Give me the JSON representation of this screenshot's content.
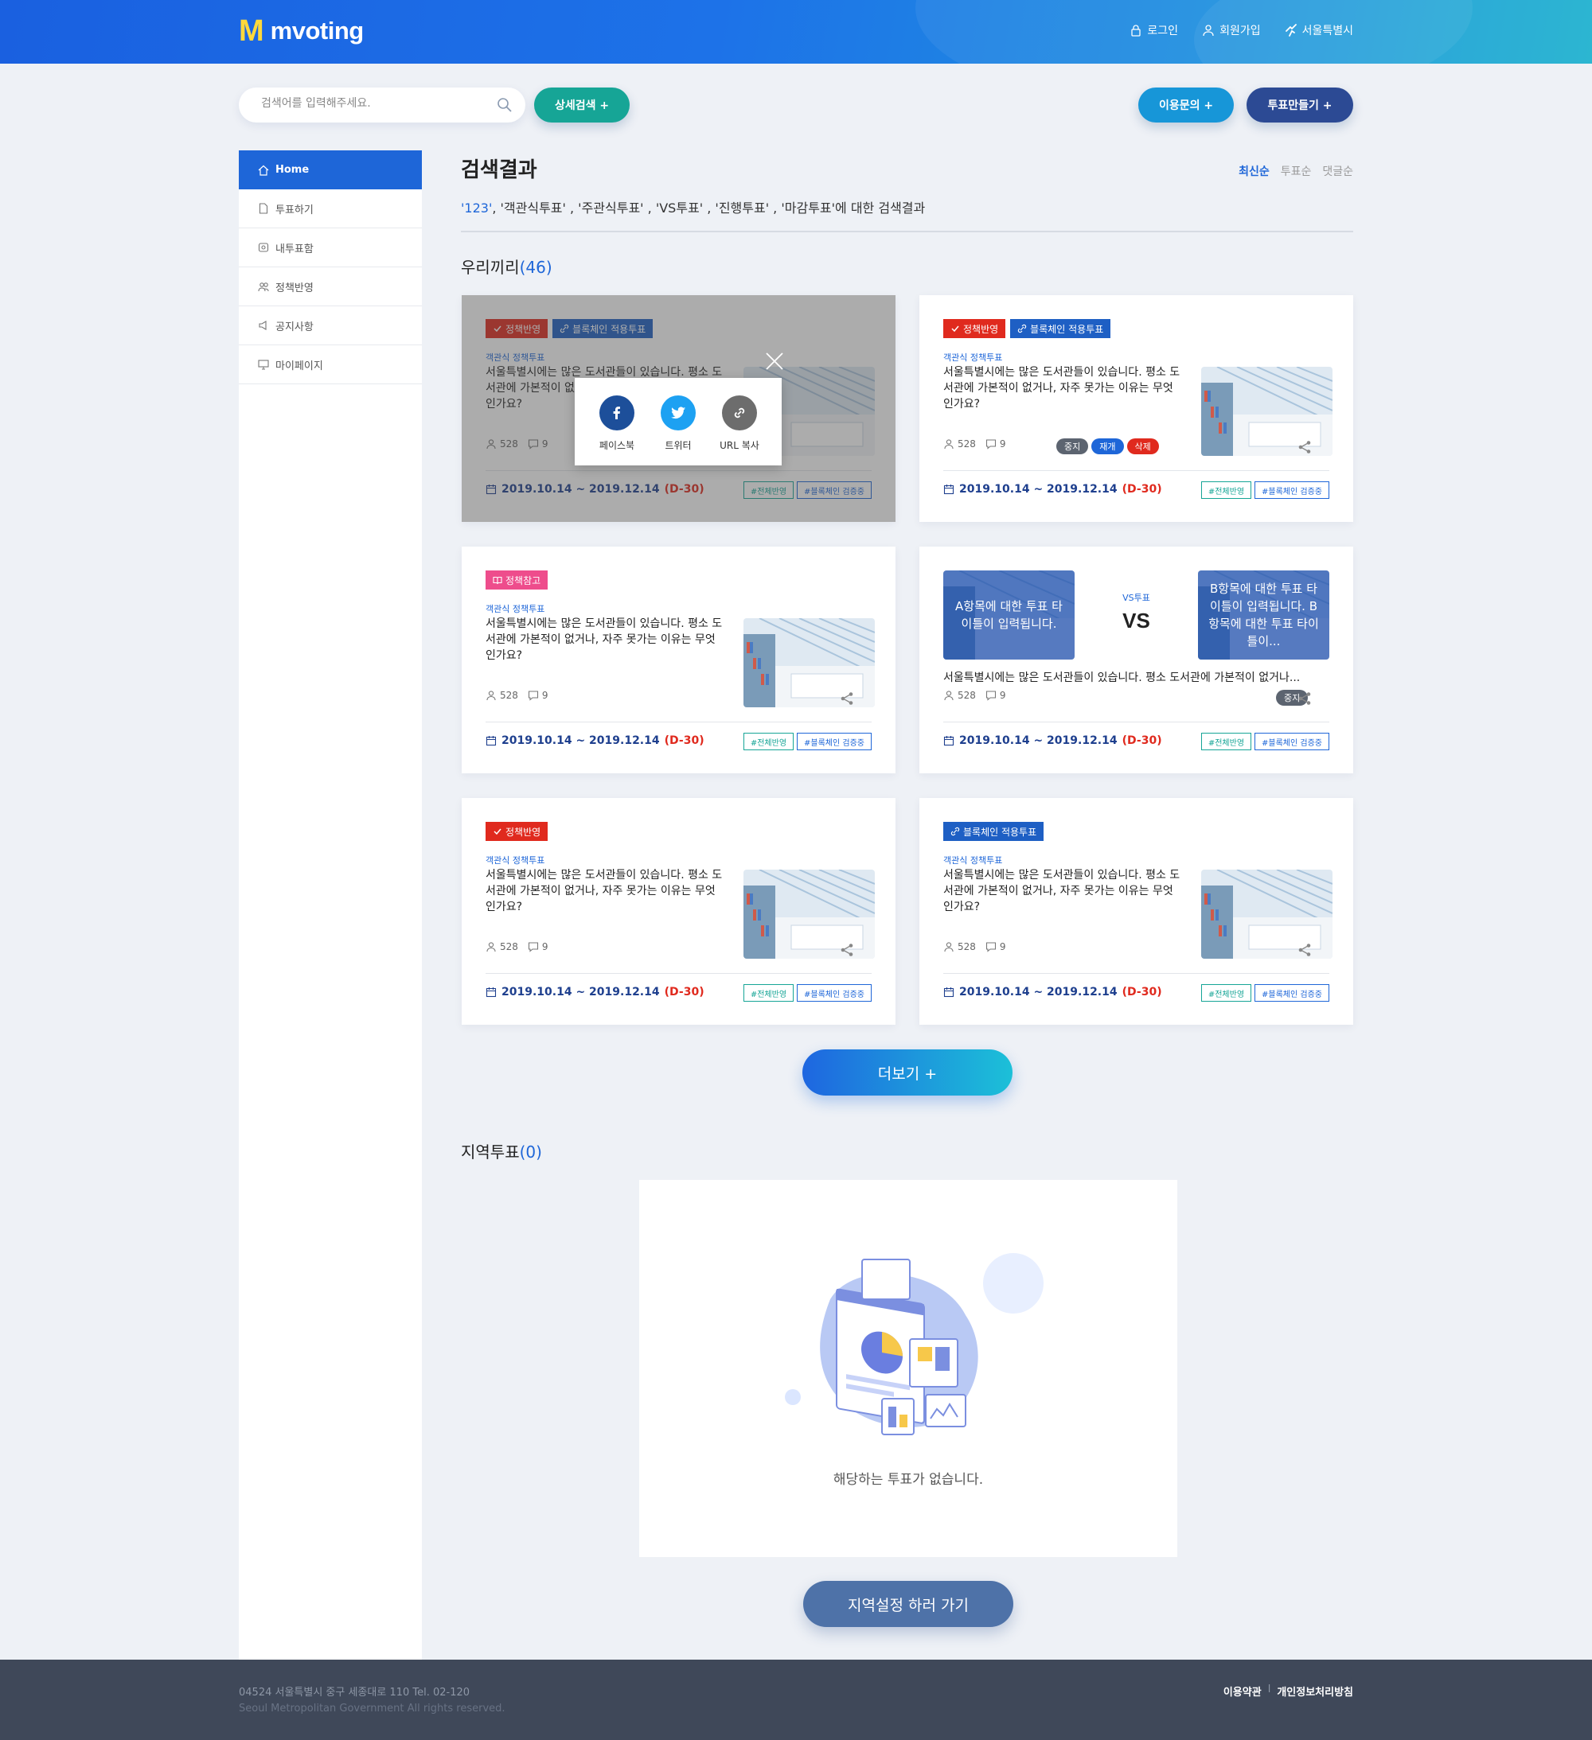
{
  "header": {
    "logo_mark": "M",
    "logo_text": "mvoting",
    "nav": [
      {
        "label": "로그인",
        "icon": "lock-icon"
      },
      {
        "label": "회원가입",
        "icon": "user-icon"
      },
      {
        "label": "서울특별시",
        "icon": "region-icon"
      }
    ]
  },
  "search": {
    "placeholder": "검색어를 입력해주세요.",
    "detail_button": "상세검색 +"
  },
  "actions": {
    "inquiry_button": "이용문의 +",
    "make_vote_button": "투표만들기 +"
  },
  "sidebar": {
    "items": [
      {
        "label": "Home",
        "icon": "home-icon"
      },
      {
        "label": "투표하기",
        "icon": "document-icon"
      },
      {
        "label": "내투표함",
        "icon": "box-icon"
      },
      {
        "label": "정책반영",
        "icon": "people-icon"
      },
      {
        "label": "공지사항",
        "icon": "speaker-icon"
      },
      {
        "label": "마이페이지",
        "icon": "monitor-icon"
      }
    ]
  },
  "results": {
    "title": "검색결과",
    "sort": [
      "최신순",
      "투표순",
      "댓글순"
    ],
    "query_highlight": "'123'",
    "query_rest": ", '객관식투표' , '주관식투표' , 'VS투표' , '진행투표' , '마감투표'에 대한 검색결과"
  },
  "section_ours": {
    "title": "우리끼리",
    "count": "(46)"
  },
  "section_region": {
    "title": "지역투표",
    "count": "(0)"
  },
  "cards": [
    {
      "tags": [
        "정책반영",
        "블록체인 적용투표"
      ],
      "category": "객관식 정책투표",
      "description": "서울특별시에는 많은 도서관들이 있습니다. 평소 도서관에 가본적이 없거나, 자주 못가는 이유는 무엇인가요?",
      "views": "528",
      "comments": "9",
      "date": "2019.10.14 ~ 2019.12.14",
      "dday": "(D-30)",
      "hashtags": [
        "#전체반영",
        "#블록체인 검증중"
      ]
    },
    {
      "tags": [
        "정책반영",
        "블록체인 적용투표"
      ],
      "category": "객관식 정책투표",
      "description": "서울특별시에는 많은 도서관들이 있습니다. 평소 도서관에 가본적이 없거나, 자주 못가는 이유는 무엇인가요?",
      "views": "528",
      "comments": "9",
      "buttons": [
        "중지",
        "재개",
        "삭제"
      ],
      "date": "2019.10.14 ~ 2019.12.14",
      "dday": "(D-30)",
      "hashtags": [
        "#전체반영",
        "#블록체인 검증중"
      ]
    },
    {
      "tags": [
        "정책참고"
      ],
      "category": "객관식 정책투표",
      "description": "서울특별시에는 많은 도서관들이 있습니다. 평소 도서관에 가본적이 없거나, 자주 못가는 이유는 무엇인가요?",
      "views": "528",
      "comments": "9",
      "date": "2019.10.14 ~ 2019.12.14",
      "dday": "(D-30)",
      "hashtags": [
        "#전체반영",
        "#블록체인 검증중"
      ]
    },
    {
      "vs_a": "A항목에 대한 투표 타이틀이 입력됩니다.",
      "vs_b": "B항목에 대한 투표 타이틀이 입력됩니다. B항목에 대한 투표 타이틀이...",
      "vs_kind": "VS투표",
      "vs_label": "VS",
      "description": "서울특별시에는 많은 도서관들이 있습니다. 평소 도서관에 가본적이 없거나...",
      "views": "528",
      "comments": "9",
      "buttons": [
        "중지"
      ],
      "date": "2019.10.14 ~ 2019.12.14",
      "dday": "(D-30)",
      "hashtags": [
        "#전체반영",
        "#블록체인 검증중"
      ]
    },
    {
      "tags": [
        "정책반영"
      ],
      "category": "객관식 정책투표",
      "description": "서울특별시에는 많은 도서관들이 있습니다. 평소 도서관에 가본적이 없거나, 자주 못가는 이유는 무엇인가요?",
      "views": "528",
      "comments": "9",
      "date": "2019.10.14 ~ 2019.12.14",
      "dday": "(D-30)",
      "hashtags": [
        "#전체반영",
        "#블록체인 검증중"
      ]
    },
    {
      "tags": [
        "블록체인 적용투표"
      ],
      "category": "객관식 정책투표",
      "description": "서울특별시에는 많은 도서관들이 있습니다. 평소 도서관에 가본적이 없거나, 자주 못가는 이유는 무엇인가요?",
      "views": "528",
      "comments": "9",
      "date": "2019.10.14 ~ 2019.12.14",
      "dday": "(D-30)",
      "hashtags": [
        "#전체반영",
        "#블록체인 검증중"
      ]
    }
  ],
  "share_popup": {
    "facebook": "페이스북",
    "twitter": "트위터",
    "url": "URL 복사"
  },
  "more_button": "더보기 +",
  "empty_message": "해당하는 투표가 없습니다.",
  "region_button": "지역설정 하러 가기",
  "footer": {
    "address": "04524 서울특별시 중구 세종대로 110     Tel. 02-120",
    "copyright": "Seoul Metropolitan Government All rights reserved.",
    "terms": "이용약관",
    "privacy": "개인정보처리방침",
    "separator": "l"
  },
  "colors": {
    "primary": "#1e66d8",
    "teal": "#16a596",
    "navy": "#2c4a94",
    "red": "#e02a1e",
    "pink": "#ee4d8c",
    "footer": "#3f4859"
  }
}
